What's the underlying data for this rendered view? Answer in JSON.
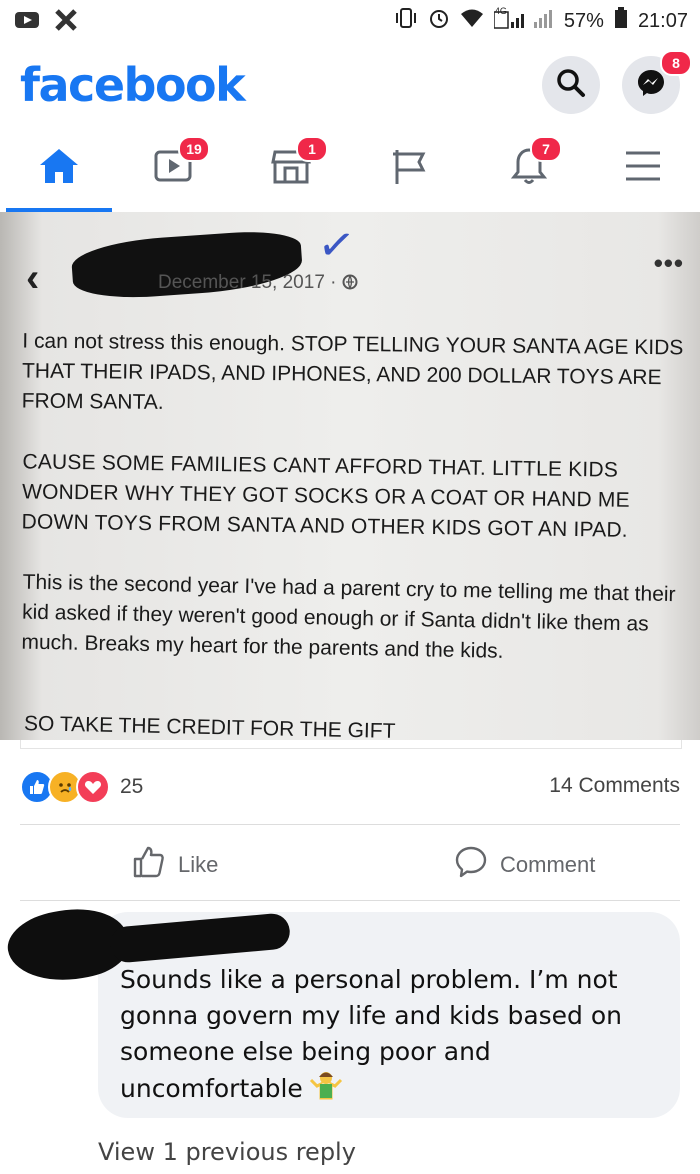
{
  "status_bar": {
    "battery": "57%",
    "time": "21:07",
    "network": "4G"
  },
  "header": {
    "logo": "facebook",
    "messenger_badge": "8"
  },
  "nav": {
    "watch_badge": "19",
    "marketplace_badge": "1",
    "notifications_badge": "7"
  },
  "post_image": {
    "date": "December 15, 2017 ·",
    "paragraph_1": "I can not stress this enough. STOP TELLING YOUR SANTA AGE KIDS THAT THEIR IPADS, AND IPHONES, AND 200 DOLLAR TOYS ARE FROM SANTA.",
    "paragraph_2": "CAUSE SOME FAMILIES CANT AFFORD THAT. LITTLE KIDS WONDER WHY THEY GOT SOCKS OR A COAT OR HAND ME DOWN TOYS FROM SANTA AND OTHER KIDS GOT AN IPAD.",
    "paragraph_3": "This is the second year I've had a parent cry to me telling me that their kid asked if they weren't good enough or if Santa didn't like them as much. Breaks my heart for the parents and the kids.",
    "paragraph_cut": "SO TAKE THE CREDIT FOR THE GIFT"
  },
  "reactions": {
    "count": "25",
    "comments_label": "14 Comments"
  },
  "actions": {
    "like_label": "Like",
    "comment_label": "Comment"
  },
  "comment": {
    "text": "Sounds like a personal problem.  I’m not gonna govern my life and kids based on someone else being poor and uncomfortable"
  },
  "view_replies": "View 1 previous reply",
  "colors": {
    "brand": "#1877f2",
    "badge": "#f02849"
  }
}
